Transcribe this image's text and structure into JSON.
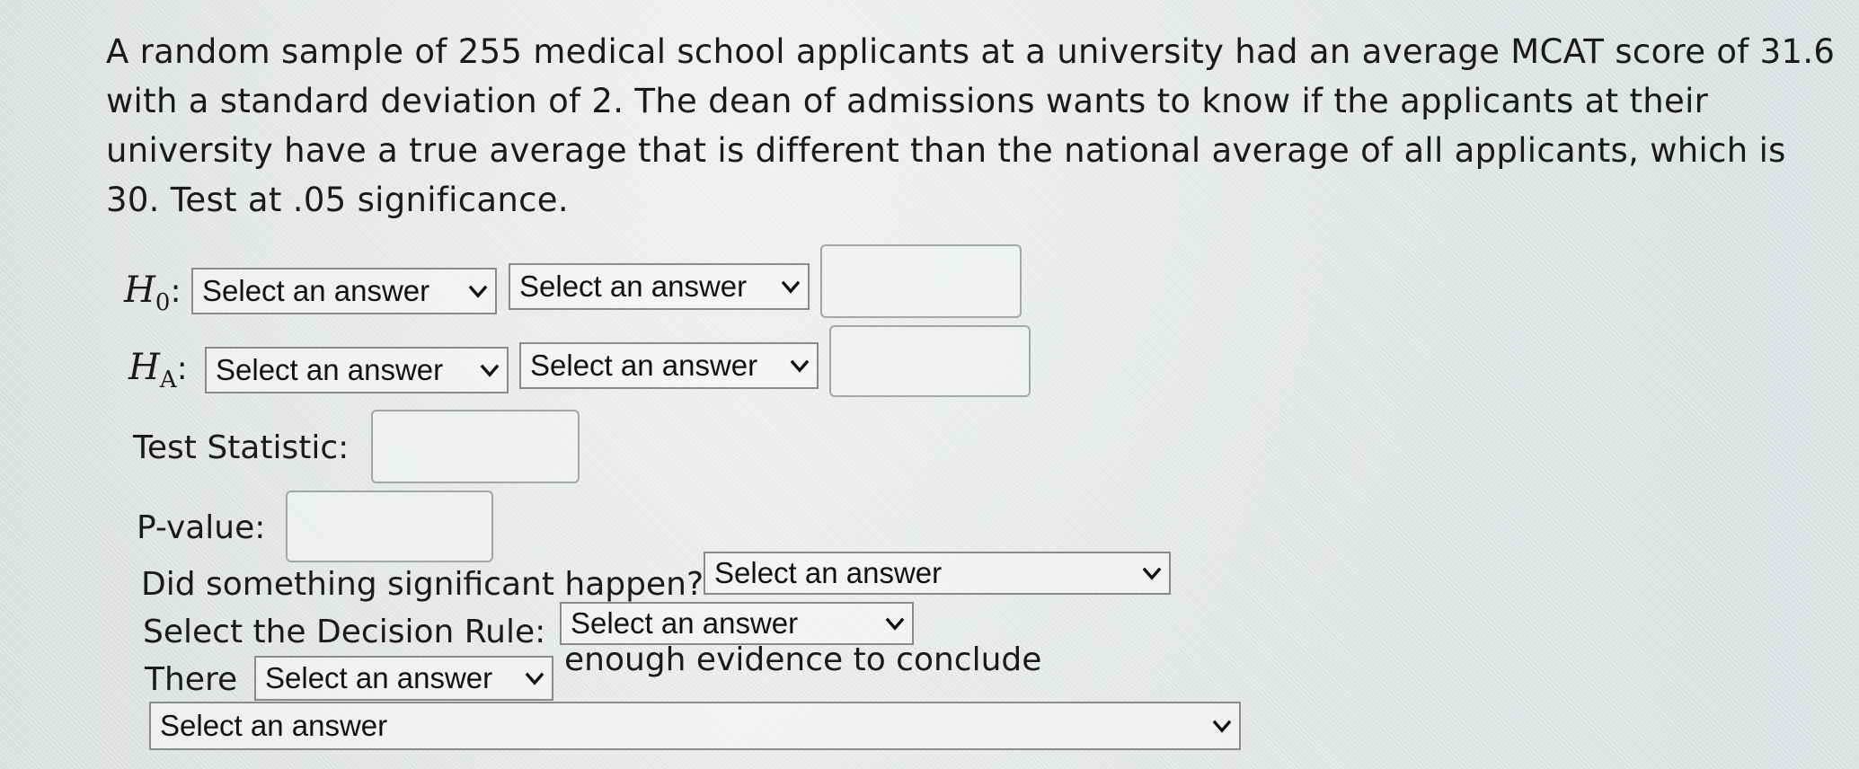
{
  "question": {
    "text": "A random sample of 255 medical school applicants at a university had an average MCAT score of 31.6 with a standard deviation of 2. The dean of admissions wants to know if the applicants at their university have a true average that is different than the national average of all applicants, which is 30. Test at .05 significance."
  },
  "h0": {
    "symbol": "H",
    "subscript": "0",
    "colon": ":",
    "select1": "Select an answer",
    "select2": "Select an answer",
    "value": ""
  },
  "ha": {
    "symbol": "H",
    "subscript": "A",
    "colon": ":",
    "select1": "Select an answer",
    "select2": "Select an answer",
    "value": ""
  },
  "test_statistic": {
    "label": "Test Statistic:",
    "value": ""
  },
  "p_value": {
    "label": "P-value:",
    "value": ""
  },
  "significance": {
    "label": "Did something significant happen?",
    "select": "Select an answer"
  },
  "decision_rule": {
    "label": "Select the Decision Rule:",
    "select": "Select an answer"
  },
  "conclusion": {
    "prefix": "There",
    "select": "Select an answer",
    "suffix": "enough evidence to conclude",
    "final_select": "Select an answer"
  },
  "icons": {
    "chevron": "chevron-down-icon"
  }
}
